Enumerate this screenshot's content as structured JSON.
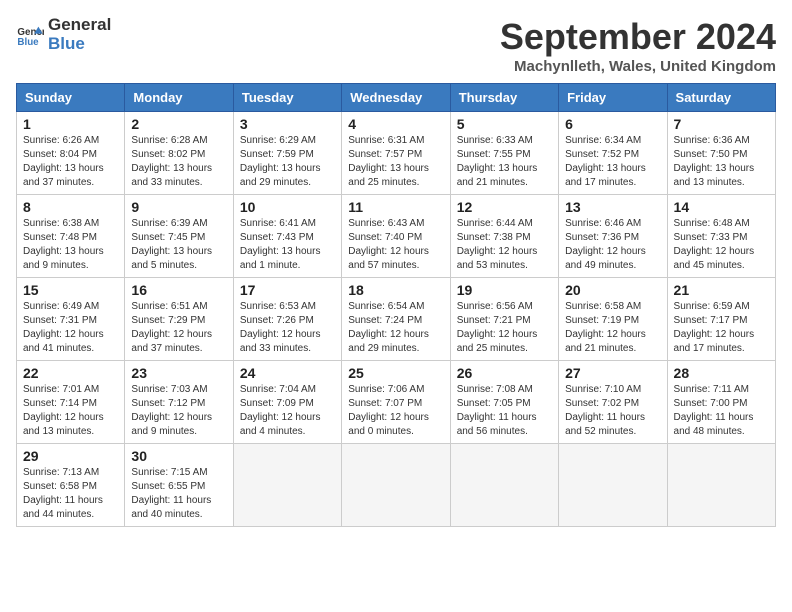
{
  "header": {
    "logo_line1": "General",
    "logo_line2": "Blue",
    "month_title": "September 2024",
    "location": "Machynlleth, Wales, United Kingdom"
  },
  "weekdays": [
    "Sunday",
    "Monday",
    "Tuesday",
    "Wednesday",
    "Thursday",
    "Friday",
    "Saturday"
  ],
  "weeks": [
    [
      {
        "day": "1",
        "info": "Sunrise: 6:26 AM\nSunset: 8:04 PM\nDaylight: 13 hours\nand 37 minutes."
      },
      {
        "day": "2",
        "info": "Sunrise: 6:28 AM\nSunset: 8:02 PM\nDaylight: 13 hours\nand 33 minutes."
      },
      {
        "day": "3",
        "info": "Sunrise: 6:29 AM\nSunset: 7:59 PM\nDaylight: 13 hours\nand 29 minutes."
      },
      {
        "day": "4",
        "info": "Sunrise: 6:31 AM\nSunset: 7:57 PM\nDaylight: 13 hours\nand 25 minutes."
      },
      {
        "day": "5",
        "info": "Sunrise: 6:33 AM\nSunset: 7:55 PM\nDaylight: 13 hours\nand 21 minutes."
      },
      {
        "day": "6",
        "info": "Sunrise: 6:34 AM\nSunset: 7:52 PM\nDaylight: 13 hours\nand 17 minutes."
      },
      {
        "day": "7",
        "info": "Sunrise: 6:36 AM\nSunset: 7:50 PM\nDaylight: 13 hours\nand 13 minutes."
      }
    ],
    [
      {
        "day": "8",
        "info": "Sunrise: 6:38 AM\nSunset: 7:48 PM\nDaylight: 13 hours\nand 9 minutes."
      },
      {
        "day": "9",
        "info": "Sunrise: 6:39 AM\nSunset: 7:45 PM\nDaylight: 13 hours\nand 5 minutes."
      },
      {
        "day": "10",
        "info": "Sunrise: 6:41 AM\nSunset: 7:43 PM\nDaylight: 13 hours\nand 1 minute."
      },
      {
        "day": "11",
        "info": "Sunrise: 6:43 AM\nSunset: 7:40 PM\nDaylight: 12 hours\nand 57 minutes."
      },
      {
        "day": "12",
        "info": "Sunrise: 6:44 AM\nSunset: 7:38 PM\nDaylight: 12 hours\nand 53 minutes."
      },
      {
        "day": "13",
        "info": "Sunrise: 6:46 AM\nSunset: 7:36 PM\nDaylight: 12 hours\nand 49 minutes."
      },
      {
        "day": "14",
        "info": "Sunrise: 6:48 AM\nSunset: 7:33 PM\nDaylight: 12 hours\nand 45 minutes."
      }
    ],
    [
      {
        "day": "15",
        "info": "Sunrise: 6:49 AM\nSunset: 7:31 PM\nDaylight: 12 hours\nand 41 minutes."
      },
      {
        "day": "16",
        "info": "Sunrise: 6:51 AM\nSunset: 7:29 PM\nDaylight: 12 hours\nand 37 minutes."
      },
      {
        "day": "17",
        "info": "Sunrise: 6:53 AM\nSunset: 7:26 PM\nDaylight: 12 hours\nand 33 minutes."
      },
      {
        "day": "18",
        "info": "Sunrise: 6:54 AM\nSunset: 7:24 PM\nDaylight: 12 hours\nand 29 minutes."
      },
      {
        "day": "19",
        "info": "Sunrise: 6:56 AM\nSunset: 7:21 PM\nDaylight: 12 hours\nand 25 minutes."
      },
      {
        "day": "20",
        "info": "Sunrise: 6:58 AM\nSunset: 7:19 PM\nDaylight: 12 hours\nand 21 minutes."
      },
      {
        "day": "21",
        "info": "Sunrise: 6:59 AM\nSunset: 7:17 PM\nDaylight: 12 hours\nand 17 minutes."
      }
    ],
    [
      {
        "day": "22",
        "info": "Sunrise: 7:01 AM\nSunset: 7:14 PM\nDaylight: 12 hours\nand 13 minutes."
      },
      {
        "day": "23",
        "info": "Sunrise: 7:03 AM\nSunset: 7:12 PM\nDaylight: 12 hours\nand 9 minutes."
      },
      {
        "day": "24",
        "info": "Sunrise: 7:04 AM\nSunset: 7:09 PM\nDaylight: 12 hours\nand 4 minutes."
      },
      {
        "day": "25",
        "info": "Sunrise: 7:06 AM\nSunset: 7:07 PM\nDaylight: 12 hours\nand 0 minutes."
      },
      {
        "day": "26",
        "info": "Sunrise: 7:08 AM\nSunset: 7:05 PM\nDaylight: 11 hours\nand 56 minutes."
      },
      {
        "day": "27",
        "info": "Sunrise: 7:10 AM\nSunset: 7:02 PM\nDaylight: 11 hours\nand 52 minutes."
      },
      {
        "day": "28",
        "info": "Sunrise: 7:11 AM\nSunset: 7:00 PM\nDaylight: 11 hours\nand 48 minutes."
      }
    ],
    [
      {
        "day": "29",
        "info": "Sunrise: 7:13 AM\nSunset: 6:58 PM\nDaylight: 11 hours\nand 44 minutes."
      },
      {
        "day": "30",
        "info": "Sunrise: 7:15 AM\nSunset: 6:55 PM\nDaylight: 11 hours\nand 40 minutes."
      },
      {
        "day": "",
        "info": ""
      },
      {
        "day": "",
        "info": ""
      },
      {
        "day": "",
        "info": ""
      },
      {
        "day": "",
        "info": ""
      },
      {
        "day": "",
        "info": ""
      }
    ]
  ]
}
